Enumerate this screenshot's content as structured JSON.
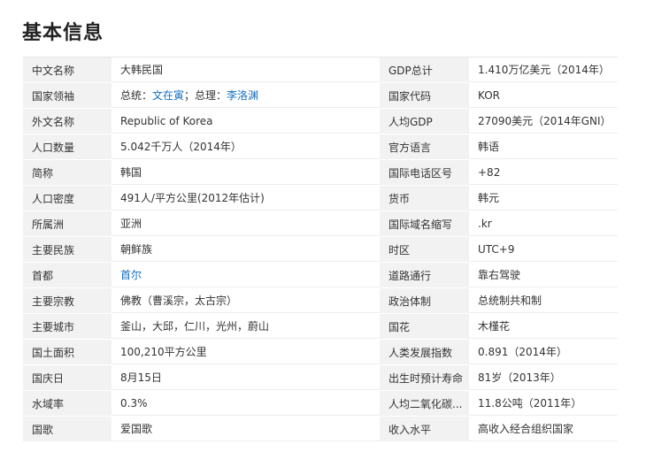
{
  "title": "基本信息",
  "link_color": "#136ec2",
  "rows": [
    {
      "l1": "中文名称",
      "v1": "大韩民国",
      "l2": "GDP总计",
      "v2": "1.410万亿美元（2014年）"
    },
    {
      "l1": "国家领袖",
      "v1": {
        "prefix": "总统：",
        "president": "文在寅",
        "mid": "；总理：",
        "premier": "李洛渊"
      },
      "l2": "国家代码",
      "v2": "KOR"
    },
    {
      "l1": "外文名称",
      "v1": "Republic of Korea",
      "l2": "人均GDP",
      "v2": "27090美元（2014年GNI）"
    },
    {
      "l1": "人口数量",
      "v1": "5.042千万人（2014年）",
      "l2": "官方语言",
      "v2": "韩语"
    },
    {
      "l1": "简称",
      "v1": "韩国",
      "l2": "国际电话区号",
      "v2": "+82"
    },
    {
      "l1": "人口密度",
      "v1": "491人/平方公里(2012年估计)",
      "l2": "货币",
      "v2": "韩元"
    },
    {
      "l1": "所属洲",
      "v1": "亚洲",
      "l2": "国际域名缩写",
      "v2": ".kr"
    },
    {
      "l1": "主要民族",
      "v1": "朝鲜族",
      "l2": "时区",
      "v2": "UTC+9"
    },
    {
      "l1": "首都",
      "v1": "首尔",
      "l2": "道路通行",
      "v2": "靠右驾驶"
    },
    {
      "l1": "主要宗教",
      "v1": "佛教（曹溪宗，太古宗）",
      "l2": "政治体制",
      "v2": "总统制共和制"
    },
    {
      "l1": "主要城市",
      "v1": "釜山，大邱，仁川，光州，蔚山",
      "l2": "国花",
      "v2": "木槿花"
    },
    {
      "l1": "国土面积",
      "v1": "100,210平方公里",
      "l2": "人类发展指数",
      "v2": "0.891（2014年）"
    },
    {
      "l1": "国庆日",
      "v1": "8月15日",
      "l2": "出生时预计寿命",
      "v2": "81岁（2013年）"
    },
    {
      "l1": "水域率",
      "v1": "0.3%",
      "l2": "人均二氧化碳...",
      "v2": "11.8公吨（2011年）"
    },
    {
      "l1": "国歌",
      "v1": "爱国歌",
      "l2": "收入水平",
      "v2": "高收入经合组织国家"
    }
  ]
}
